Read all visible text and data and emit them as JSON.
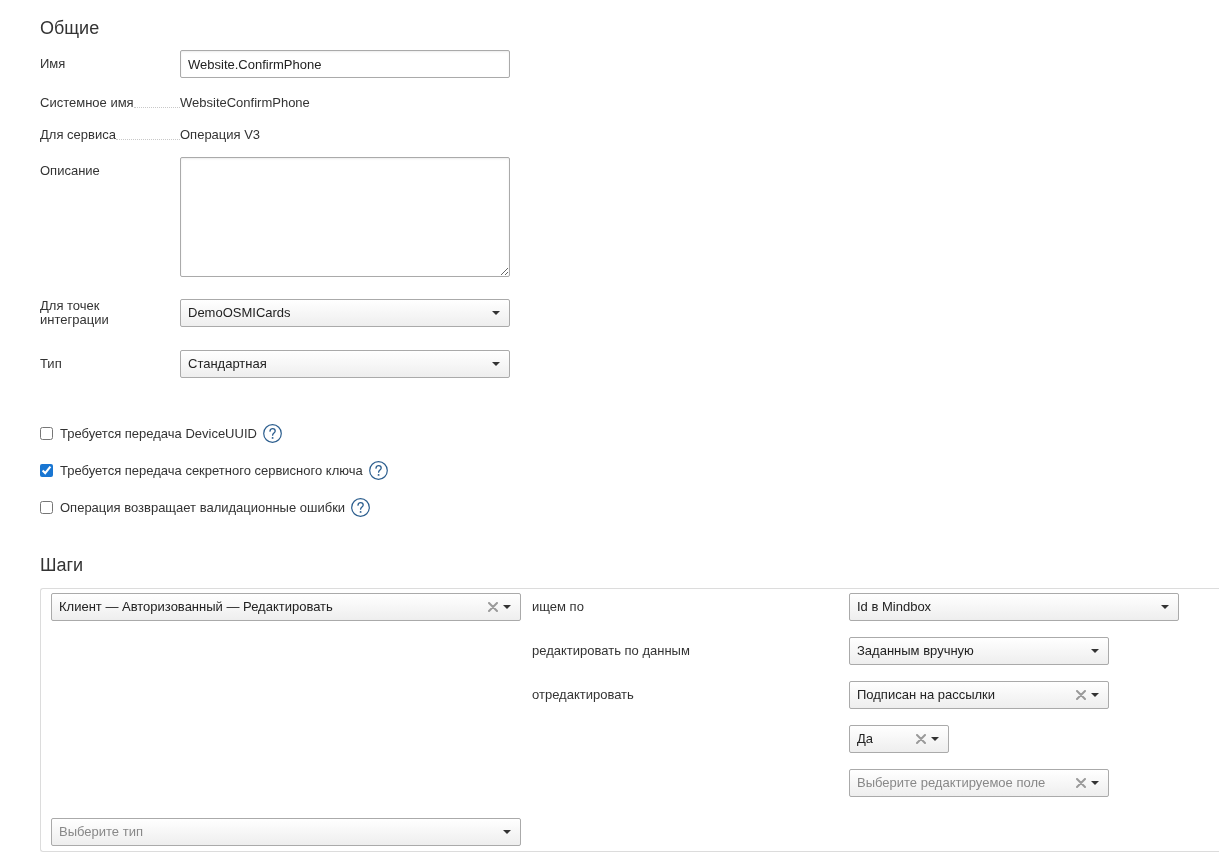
{
  "general": {
    "heading": "Общие",
    "fields": [
      {
        "kind": "input",
        "label": "Имя",
        "value": "Website.ConfirmPhone"
      },
      {
        "kind": "static",
        "label": "Системное имя",
        "value": "WebsiteConfirmPhone"
      },
      {
        "kind": "static",
        "label": "Для сервиса",
        "value": "Операция V3"
      },
      {
        "kind": "textarea",
        "label": "Описание"
      },
      {
        "kind": "select",
        "label": "Для точек интеграции",
        "value": "DemoOSMICards"
      },
      {
        "kind": "select",
        "label": "Тип",
        "value": "Стандартная"
      }
    ]
  },
  "options": [
    {
      "label": "Требуется передача DeviceUUID",
      "checked": false
    },
    {
      "label": "Требуется передача секретного сервисного ключа",
      "checked": true
    },
    {
      "label": "Операция возвращает валидационные ошибки",
      "checked": false
    }
  ],
  "steps": {
    "heading": "Шаги",
    "action": {
      "value": "Клиент — Авторизованный — Редактировать",
      "clearable": true
    },
    "params": [
      {
        "label": "ищем по",
        "select": {
          "value": "Id в Mindbox",
          "clearable": false
        }
      },
      {
        "label": "редактировать по данным",
        "select": {
          "value": "Заданным вручную",
          "clearable": false
        }
      },
      {
        "label": "отредактировать",
        "edits": [
          {
            "field": {
              "value": "Подписан на рассылки",
              "clearable": true
            },
            "value": {
              "value": "Да",
              "clearable": true
            }
          }
        ],
        "new_field": {
          "placeholder": "Выберите редактируемое поле",
          "clearable": true
        }
      }
    ],
    "add_step": {
      "placeholder": "Выберите тип",
      "clearable": false
    }
  }
}
